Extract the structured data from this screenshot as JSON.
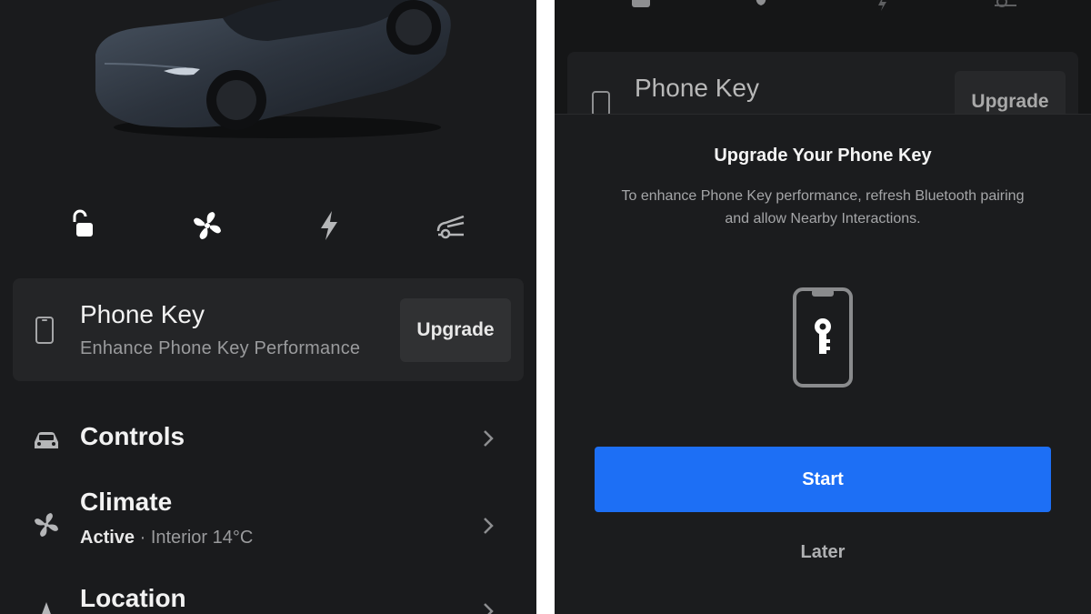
{
  "left": {
    "quick_actions": [
      "unlock-icon",
      "fan-icon",
      "charge-icon",
      "frunk-icon"
    ],
    "phone_key": {
      "title": "Phone Key",
      "subtitle": "Enhance Phone Key Performance",
      "button_label": "Upgrade"
    },
    "menu": {
      "controls": {
        "label": "Controls"
      },
      "climate": {
        "label": "Climate",
        "status": "Active",
        "separator": " · ",
        "detail": "Interior 14°C"
      },
      "location": {
        "label": "Location"
      }
    }
  },
  "right": {
    "background": {
      "phone_key_title": "Phone Key",
      "upgrade_label": "Upgrade"
    },
    "sheet": {
      "title": "Upgrade Your Phone Key",
      "description": "To enhance Phone Key performance, refresh Bluetooth pairing and allow Nearby Interactions.",
      "start_label": "Start",
      "later_label": "Later"
    }
  },
  "colors": {
    "background": "#1a1b1d",
    "card": "#242527",
    "accent_blue": "#1d6ff5"
  }
}
